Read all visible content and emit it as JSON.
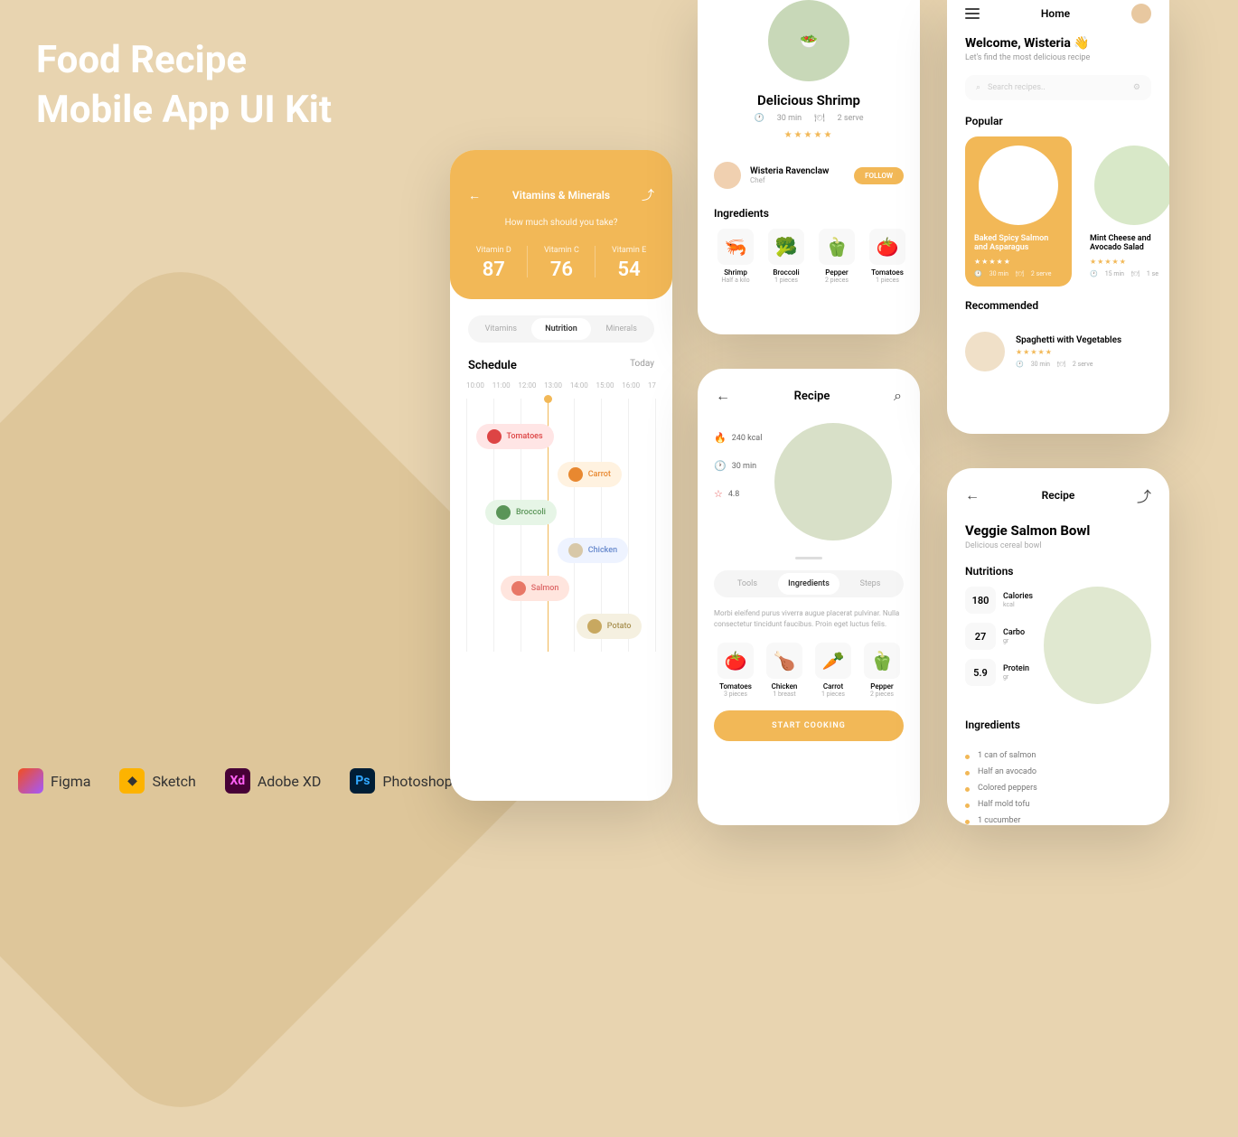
{
  "title_line1": "Food Recipe",
  "title_line2": "Mobile App UI Kit",
  "tools": {
    "figma": "Figma",
    "sketch": "Sketch",
    "xd": "Adobe XD",
    "ps": "Photoshop"
  },
  "phone1": {
    "title": "Vitamins & Minerals",
    "subtitle": "How much should you take?",
    "stats": [
      {
        "label": "Vitamin D",
        "val": "87"
      },
      {
        "label": "Vitamin C",
        "val": "76"
      },
      {
        "label": "Vitamin E",
        "val": "54"
      }
    ],
    "tabs": [
      "Vitamins",
      "Nutrition",
      "Minerals"
    ],
    "schedule": "Schedule",
    "today": "Today",
    "times": [
      "10:00",
      "11:00",
      "12:00",
      "13:00",
      "14:00",
      "15:00",
      "16:00",
      "17"
    ],
    "pills": {
      "tomato": "Tomatoes",
      "carrot": "Carrot",
      "broccoli": "Broccoli",
      "chicken": "Chicken",
      "salmon": "Salmon",
      "potato": "Potato"
    }
  },
  "phone2": {
    "title": "Delicious Shrimp",
    "time": "30 min",
    "serve": "2 serve",
    "chef_name": "Wisteria Ravenclaw",
    "chef_role": "Chef",
    "follow": "FOLLOW",
    "ing_title": "Ingredients",
    "ingredients": [
      {
        "n": "Shrimp",
        "q": "Half a kilo"
      },
      {
        "n": "Broccoli",
        "q": "1 pieces"
      },
      {
        "n": "Pepper",
        "q": "2 pieces"
      },
      {
        "n": "Tomatoes",
        "q": "1 pieces"
      }
    ]
  },
  "phone3": {
    "title": "Recipe",
    "kcal": "240 kcal",
    "time": "30 min",
    "rating": "4.8",
    "tabs": [
      "Tools",
      "Ingredients",
      "Steps"
    ],
    "desc": "Morbi eleifend purus viverra augue placerat pulvinar. Nulla consectetur tincidunt faucibus. Proin eget luctus felis.",
    "ingredients": [
      {
        "n": "Tomatoes",
        "q": "3 pieces"
      },
      {
        "n": "Chicken",
        "q": "1 breast"
      },
      {
        "n": "Carrot",
        "q": "1 pieces"
      },
      {
        "n": "Pepper",
        "q": "2 pieces"
      }
    ],
    "cta": "START COOKING"
  },
  "phone4": {
    "title": "Home",
    "welcome": "Welcome, Wisteria 👋",
    "sub": "Let's find the most delicious recipe",
    "search": "Search recipes..",
    "popular": "Popular",
    "recommended": "Recommended",
    "cards": [
      {
        "t": "Baked Spicy Salmon and Asparagus",
        "time": "30 min",
        "serve": "2 serve"
      },
      {
        "t": "Mint Cheese and Avocado Salad",
        "time": "15 min",
        "serve": "1 se"
      }
    ],
    "rec": {
      "t": "Spaghetti with Vegetables",
      "time": "30 min",
      "serve": "2 serve"
    }
  },
  "phone5": {
    "title": "Recipe",
    "name": "Veggie Salmon Bowl",
    "sub": "Delicious cereal bowl",
    "nutr_title": "Nutritions",
    "nutr": [
      {
        "v": "180",
        "l": "Calories",
        "u": "kcal"
      },
      {
        "v": "27",
        "l": "Carbo",
        "u": "gr"
      },
      {
        "v": "5.9",
        "l": "Protein",
        "u": "gr"
      }
    ],
    "ing_title": "Ingredients",
    "ingredients": [
      "1 can of salmon",
      "Half an avocado",
      "Colored peppers",
      "Half mold tofu",
      "1 cucumber"
    ]
  }
}
